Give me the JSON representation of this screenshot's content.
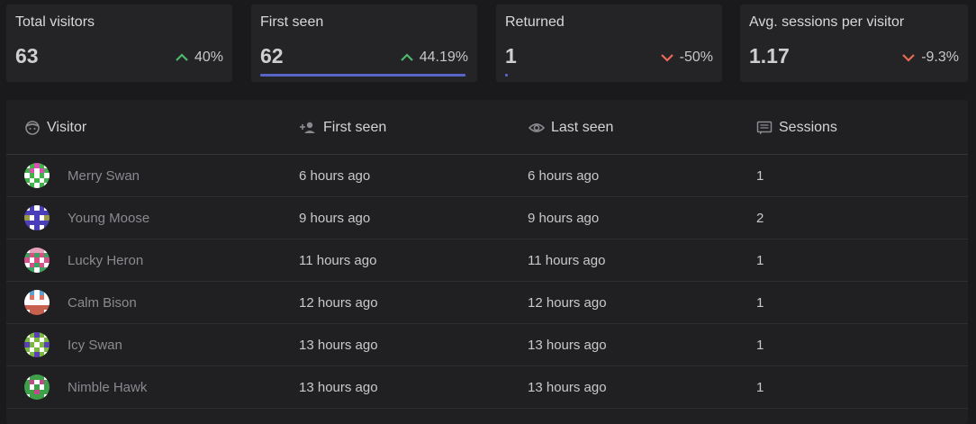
{
  "stats": [
    {
      "label": "Total visitors",
      "value": "63",
      "change": "40%",
      "direction": "up",
      "selected": false
    },
    {
      "label": "First seen",
      "value": "62",
      "change": "44.19%",
      "direction": "up",
      "selected": true
    },
    {
      "label": "Returned",
      "value": "1",
      "change": "-50%",
      "direction": "down",
      "selected": false
    },
    {
      "label": "Avg. sessions per visitor",
      "value": "1.17",
      "change": "-9.3%",
      "direction": "down",
      "selected": false
    }
  ],
  "colors": {
    "up": "#4cb96b",
    "down": "#e86a55",
    "accent": "#5865c8"
  },
  "table": {
    "columns": [
      {
        "label": "Visitor",
        "icon": "face-icon"
      },
      {
        "label": "First seen",
        "icon": "person-add-icon"
      },
      {
        "label": "Last seen",
        "icon": "eye-icon"
      },
      {
        "label": "Sessions",
        "icon": "message-list-icon"
      }
    ],
    "rows": [
      {
        "name": "Merry Swan",
        "first_seen": "6 hours ago",
        "last_seen": "6 hours ago",
        "sessions": "1",
        "avatar": [
          "#ffffff",
          "#3fb24a",
          "#d94fb2",
          "#3fb24a",
          "#ffffff",
          "#3fb24a",
          "#d94fb2",
          "#ffffff",
          "#d94fb2",
          "#3fb24a",
          "#ffffff",
          "#3fb24a",
          "#ffffff",
          "#3fb24a",
          "#ffffff",
          "#3fb24a",
          "#ffffff",
          "#3fb24a",
          "#ffffff",
          "#3fb24a",
          "#ffffff",
          "#3fb24a",
          "#ffffff",
          "#3fb24a",
          "#ffffff"
        ]
      },
      {
        "name": "Young Moose",
        "first_seen": "9 hours ago",
        "last_seen": "9 hours ago",
        "sessions": "2",
        "avatar": [
          "#ffffff",
          "#4a3fb8",
          "#ffffff",
          "#4a3fb8",
          "#ffffff",
          "#4a3fb8",
          "#4a3fb8",
          "#4a3fb8",
          "#4a3fb8",
          "#4a3fb8",
          "#9a9a40",
          "#ffffff",
          "#4a3fb8",
          "#ffffff",
          "#9a9a40",
          "#4a3fb8",
          "#4a3fb8",
          "#4a3fb8",
          "#4a3fb8",
          "#4a3fb8",
          "#4a3fb8",
          "#ffffff",
          "#4a3fb8",
          "#ffffff",
          "#4a3fb8"
        ]
      },
      {
        "name": "Lucky Heron",
        "first_seen": "11 hours ago",
        "last_seen": "11 hours ago",
        "sessions": "1",
        "avatar": [
          "#ffffff",
          "#e8a0b8",
          "#e8a0b8",
          "#e8a0b8",
          "#ffffff",
          "#3fa060",
          "#d94f8a",
          "#3fa060",
          "#d94f8a",
          "#3fa060",
          "#d94f8a",
          "#ffffff",
          "#d94f8a",
          "#ffffff",
          "#d94f8a",
          "#ffffff",
          "#d94f8a",
          "#3fa060",
          "#d94f8a",
          "#ffffff",
          "#3fa060",
          "#3fa060",
          "#ffffff",
          "#3fa060",
          "#3fa060"
        ]
      },
      {
        "name": "Calm Bison",
        "first_seen": "12 hours ago",
        "last_seen": "12 hours ago",
        "sessions": "1",
        "avatar": [
          "#ffffff",
          "#5aa0d0",
          "#ffffff",
          "#5aa0d0",
          "#ffffff",
          "#ffffff",
          "#e07060",
          "#ffffff",
          "#e07060",
          "#ffffff",
          "#ffffff",
          "#ffffff",
          "#ffffff",
          "#ffffff",
          "#ffffff",
          "#c86050",
          "#c86050",
          "#c86050",
          "#c86050",
          "#c86050",
          "#ffffff",
          "#c86050",
          "#c86050",
          "#c86050",
          "#ffffff"
        ]
      },
      {
        "name": "Icy Swan",
        "first_seen": "13 hours ago",
        "last_seen": "13 hours ago",
        "sessions": "1",
        "avatar": [
          "#ffffff",
          "#7ab83f",
          "#5a3fb8",
          "#7ab83f",
          "#ffffff",
          "#7ab83f",
          "#ffffff",
          "#7ab83f",
          "#ffffff",
          "#7ab83f",
          "#5a3fb8",
          "#7ab83f",
          "#ffffff",
          "#7ab83f",
          "#5a3fb8",
          "#7ab83f",
          "#ffffff",
          "#7ab83f",
          "#ffffff",
          "#7ab83f",
          "#ffffff",
          "#7ab83f",
          "#5a3fb8",
          "#7ab83f",
          "#ffffff"
        ]
      },
      {
        "name": "Nimble Hawk",
        "first_seen": "13 hours ago",
        "last_seen": "13 hours ago",
        "sessions": "1",
        "avatar": [
          "#ffffff",
          "#3fa04a",
          "#3fa04a",
          "#3fa04a",
          "#ffffff",
          "#3fa04a",
          "#c04a8a",
          "#ffffff",
          "#c04a8a",
          "#3fa04a",
          "#3fa04a",
          "#ffffff",
          "#3fa04a",
          "#ffffff",
          "#3fa04a",
          "#3fa04a",
          "#3fa04a",
          "#c04a8a",
          "#3fa04a",
          "#3fa04a",
          "#ffffff",
          "#3fa04a",
          "#3fa04a",
          "#3fa04a",
          "#ffffff"
        ]
      }
    ]
  }
}
